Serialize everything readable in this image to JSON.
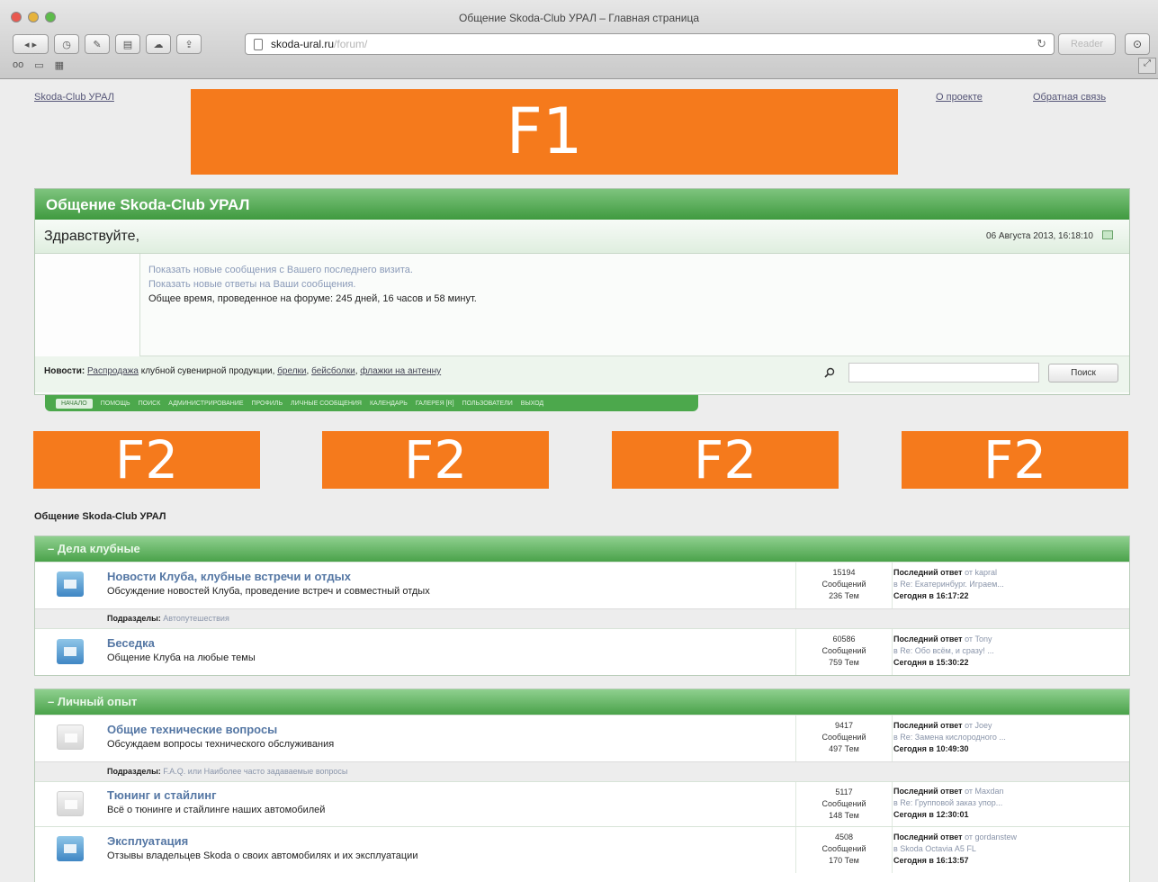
{
  "window": {
    "title": "Общение Skoda-Club УРАЛ – Главная страница",
    "url_host": "skoda-ural.ru",
    "url_path": "/forum/",
    "reader_label": "Reader"
  },
  "top_links": {
    "left": "Skoda-Club УРАЛ",
    "about": "О проекте",
    "contact": "Обратная связь"
  },
  "placeholders": {
    "f1": "F1",
    "f2": [
      "F2",
      "F2",
      "F2",
      "F2"
    ]
  },
  "header": {
    "title": "Общение Skoda-Club УРАЛ",
    "greeting": "Здравствуйте,",
    "date": "06 Августа 2013, 16:18:10",
    "lines": [
      "Показать новые сообщения с Вашего последнего визита.",
      "Показать новые ответы на Ваши сообщения.",
      "Общее время, проведенное на форуме: 245 дней, 16 часов и 58 минут."
    ],
    "news_label": "Новости:",
    "news_text_1": "Распродажа",
    "news_text_2": " клубной сувенирной продукции, ",
    "news_text_3": "брелки",
    "news_text_4": ", ",
    "news_text_5": "бейсболки",
    "news_text_6": ", ",
    "news_text_7": "флажки на антенну",
    "search_button": "Поиск"
  },
  "navbar": [
    "НАЧАЛО",
    "ПОМОЩЬ",
    "ПОИСК",
    "АДМИНИСТРИРОВАНИЕ",
    "ПРОФИЛЬ",
    "ЛИЧНЫЕ СООБЩЕНИЯ",
    "КАЛЕНДАРЬ",
    "ГАЛЕРЕЯ [R]",
    "ПОЛЬЗОВАТЕЛИ",
    "ВЫХОД"
  ],
  "breadcrumb": "Общение Skoda-Club УРАЛ",
  "categories": [
    {
      "name": "Дела клубные",
      "boards": [
        {
          "title": "Новости Клуба, клубные встречи и отдых",
          "desc": "Обсуждение новостей Клуба, проведение встреч и совместный отдых",
          "posts": "15194",
          "posts_label": "Сообщений",
          "topics": "236 Тем",
          "last_label": "Последний ответ",
          "last_by": "от kapral",
          "last_in": "в Re: Екатеринбург. Играем...",
          "last_when": "Сегодня в 16:17:22",
          "subforums_label": "Подразделы:",
          "subforums": "Автопутешествия"
        },
        {
          "title": "Беседка",
          "desc": "Общение Клуба на любые темы",
          "posts": "60586",
          "posts_label": "Сообщений",
          "topics": "759 Тем",
          "last_label": "Последний ответ",
          "last_by": "от Tony",
          "last_in": "в Re: Обо всём, и сразу! ...",
          "last_when": "Сегодня в 15:30:22"
        }
      ]
    },
    {
      "name": "Личный опыт",
      "boards": [
        {
          "title": "Общие технические вопросы",
          "desc": "Обсуждаем вопросы технического обслуживания",
          "posts": "9417",
          "posts_label": "Сообщений",
          "topics": "497 Тем",
          "last_label": "Последний ответ",
          "last_by": "от Joey",
          "last_in": "в Re: Замена кислородного ...",
          "last_when": "Сегодня в 10:49:30",
          "subforums_label": "Подразделы:",
          "subforums": "F.A.Q. или Наиболее часто задаваемые вопросы"
        },
        {
          "title": "Тюнинг и стайлинг",
          "desc": "Всё о тюнинге и стайлинге наших автомобилей",
          "posts": "5117",
          "posts_label": "Сообщений",
          "topics": "148 Тем",
          "last_label": "Последний ответ",
          "last_by": "от Maxdan",
          "last_in": "в Re: Групповой заказ упор...",
          "last_when": "Сегодня в 12:30:01"
        },
        {
          "title": "Эксплуатация",
          "desc": "Отзывы владельцев Skoda о своих автомобилях и их эксплуатации",
          "posts": "4508",
          "posts_label": "Сообщений",
          "topics": "170 Тем",
          "last_label": "Последний ответ",
          "last_by": "от gordanstew",
          "last_in": "в Skoda Octavia A5 FL",
          "last_when": "Сегодня в 16:13:57"
        }
      ]
    }
  ]
}
